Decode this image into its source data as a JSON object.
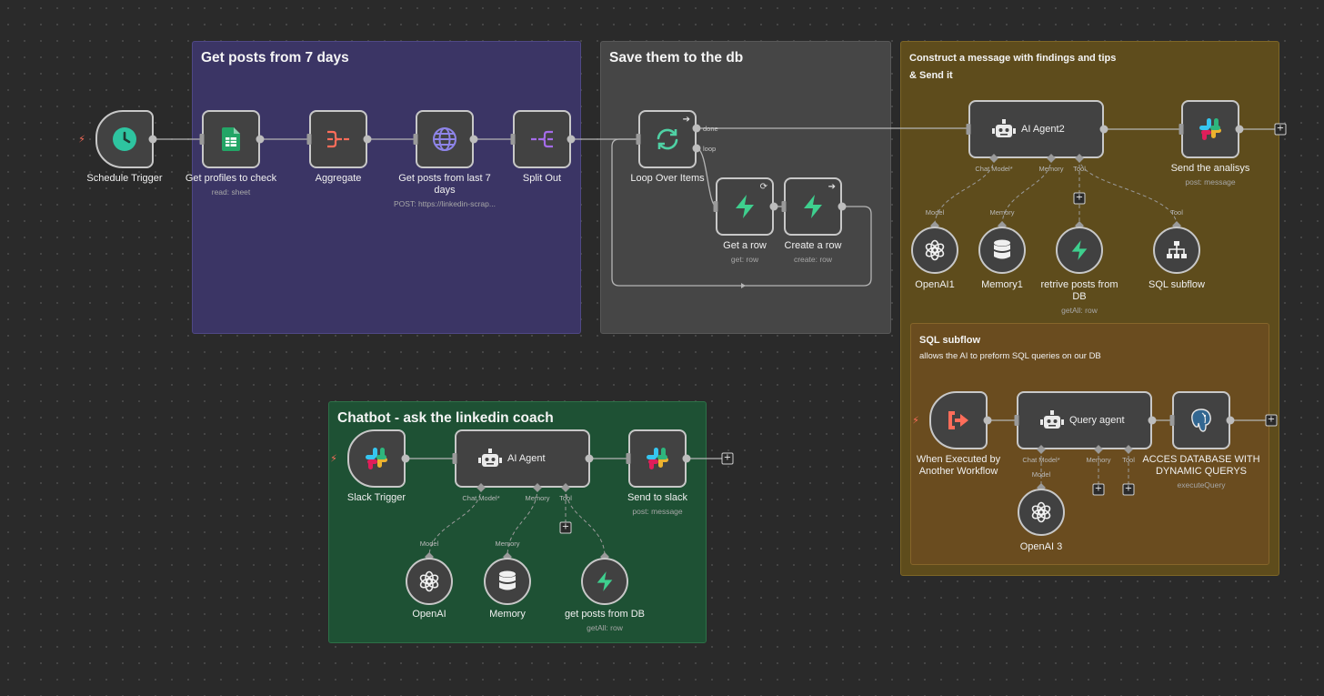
{
  "stickies": {
    "get_posts": {
      "title": "Get posts from 7 days"
    },
    "save_db": {
      "title": "Save them to the db"
    },
    "construct": {
      "title_line1": "Construct a message with findings and tips",
      "title_line2": "& Send it"
    },
    "sql_subflow": {
      "title": "SQL subflow",
      "subtitle": "allows the AI to preform SQL queries on our DB"
    },
    "chatbot": {
      "title": "Chatbot - ask the linkedin coach"
    }
  },
  "nodes": {
    "schedule_trigger": {
      "name": "Schedule Trigger",
      "icon": "clock-icon"
    },
    "get_profiles": {
      "name": "Get profiles to check",
      "subtitle": "read: sheet",
      "icon": "google-sheets-icon"
    },
    "aggregate": {
      "name": "Aggregate",
      "icon": "aggregate-icon"
    },
    "get_posts": {
      "name_line1": "Get posts from last 7",
      "name_line2": "days",
      "subtitle": "POST: https://linkedin-scrap...",
      "icon": "globe-icon"
    },
    "split_out": {
      "name": "Split Out",
      "icon": "split-out-icon"
    },
    "loop": {
      "name": "Loop Over Items",
      "output_done": "done",
      "output_loop": "loop",
      "icon": "loop-icon"
    },
    "get_row": {
      "name": "Get a row",
      "subtitle": "get: row",
      "icon": "supabase-icon"
    },
    "create_row": {
      "name": "Create a row",
      "subtitle": "create: row",
      "icon": "supabase-icon"
    },
    "ai_agent2": {
      "name": "AI Agent2",
      "icon": "robot-icon"
    },
    "send_analysis": {
      "name": "Send the analisys",
      "subtitle": "post: message",
      "icon": "slack-icon"
    },
    "openai1": {
      "name": "OpenAI1",
      "icon": "openai-icon"
    },
    "memory1": {
      "name": "Memory1",
      "icon": "database-icon"
    },
    "retrive_posts": {
      "name_line1": "retrive posts from",
      "name_line2": "DB",
      "subtitle": "getAll: row",
      "icon": "supabase-icon"
    },
    "sql_subflow_tool": {
      "name": "SQL subflow",
      "icon": "sitemap-icon"
    },
    "exec_trigger": {
      "name_line1": "When Executed by",
      "name_line2": "Another Workflow",
      "icon": "sign-in-icon"
    },
    "query_agent": {
      "name": "Query agent",
      "icon": "robot-icon"
    },
    "postgres": {
      "name_line1": "ACCES DATABASE WITH",
      "name_line2": "DYNAMIC QUERYS",
      "subtitle": "executeQuery",
      "icon": "postgres-icon"
    },
    "openai3": {
      "name": "OpenAI 3",
      "icon": "openai-icon"
    },
    "slack_trigger": {
      "name": "Slack Trigger",
      "icon": "slack-icon"
    },
    "ai_agent": {
      "name": "AI Agent",
      "icon": "robot-icon"
    },
    "send_slack": {
      "name": "Send to slack",
      "subtitle": "post: message",
      "icon": "slack-icon"
    },
    "openai": {
      "name": "OpenAI",
      "icon": "openai-icon"
    },
    "memory": {
      "name": "Memory",
      "icon": "database-icon"
    },
    "get_posts_db": {
      "name": "get posts from DB",
      "subtitle": "getAll: row",
      "icon": "supabase-icon"
    }
  },
  "ports": {
    "chat_model_req": "Chat Model*",
    "memory": "Memory",
    "tool": "Tool",
    "model": "Model"
  },
  "colors": {
    "canvas": "#2a2a2a",
    "purple_sticky": "#3b3565",
    "grey_sticky": "#464646",
    "olive_sticky": "#5e4c1c",
    "green_sticky": "#1e5134",
    "trigger_accent": "#ff6d5a",
    "supabase": "#3ecf8e",
    "schedule": "#2ec4a0"
  }
}
